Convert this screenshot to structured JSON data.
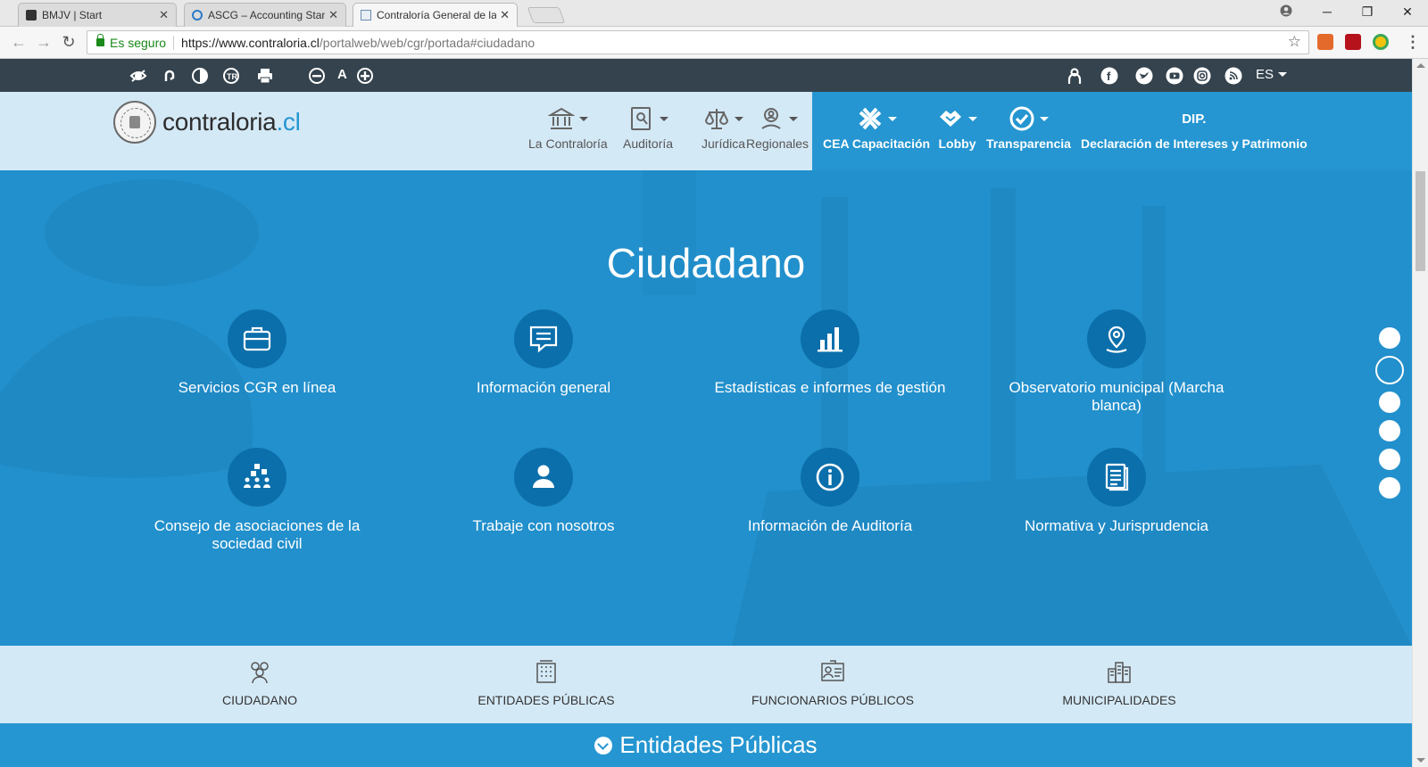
{
  "browser": {
    "tabs": [
      {
        "title": "BMJV | Start",
        "active": false
      },
      {
        "title": "ASCG – Accounting Stanc",
        "active": false
      },
      {
        "title": "Contraloría General de la",
        "active": true
      }
    ],
    "security_label": "Es seguro",
    "url_host": "https://www.contraloria.cl",
    "url_path": "/portalweb/web/cgr/portada#ciudadano"
  },
  "utility": {
    "lang": "ES"
  },
  "logo": {
    "name": "contraloria",
    "tld": ".cl"
  },
  "nav": {
    "light": [
      {
        "label": "La Contraloría",
        "icon": "bank-icon"
      },
      {
        "label": "Auditoría",
        "icon": "audit-icon"
      },
      {
        "label": "Jurídica",
        "icon": "scales-icon"
      },
      {
        "label": "Regionales",
        "icon": "location-user-icon"
      }
    ],
    "dark": [
      {
        "label": "CEA Capacitación",
        "icon": "cea-icon"
      },
      {
        "label": "Lobby",
        "icon": "handshake-icon"
      },
      {
        "label": "Transparencia",
        "icon": "check-circle-icon"
      },
      {
        "label": "Declaración de Intereses y Patrimonio",
        "icon_text": "DIP."
      }
    ]
  },
  "hero": {
    "title": "Ciudadano",
    "services": [
      {
        "label": "Servicios CGR en línea",
        "icon": "briefcase-icon"
      },
      {
        "label": "Información general",
        "icon": "chat-icon"
      },
      {
        "label": "Estadísticas e informes de gestión",
        "icon": "bar-chart-icon"
      },
      {
        "label": "Observatorio municipal (Marcha blanca)",
        "icon": "map-pin-icon"
      },
      {
        "label": "Consejo de asociaciones de la sociedad civil",
        "icon": "group-icon"
      },
      {
        "label": "Trabaje con nosotros",
        "icon": "user-icon"
      },
      {
        "label": "Información de Auditoría",
        "icon": "info-icon"
      },
      {
        "label": "Normativa y Jurisprudencia",
        "icon": "document-icon"
      }
    ]
  },
  "audience": [
    {
      "label": "CIUDADANO",
      "icon": "people-icon"
    },
    {
      "label": "ENTIDADES PÚBLICAS",
      "icon": "building-icon"
    },
    {
      "label": "FUNCIONARIOS PÚBLICOS",
      "icon": "id-card-icon"
    },
    {
      "label": "MUNICIPALIDADES",
      "icon": "city-icon"
    }
  ],
  "section": {
    "title": "Entidades Públicas"
  },
  "colors": {
    "accent": "#2596d1",
    "dark_bar": "#34434d",
    "light_header": "#d4e9f6",
    "icon_circle": "#0b6fab"
  }
}
